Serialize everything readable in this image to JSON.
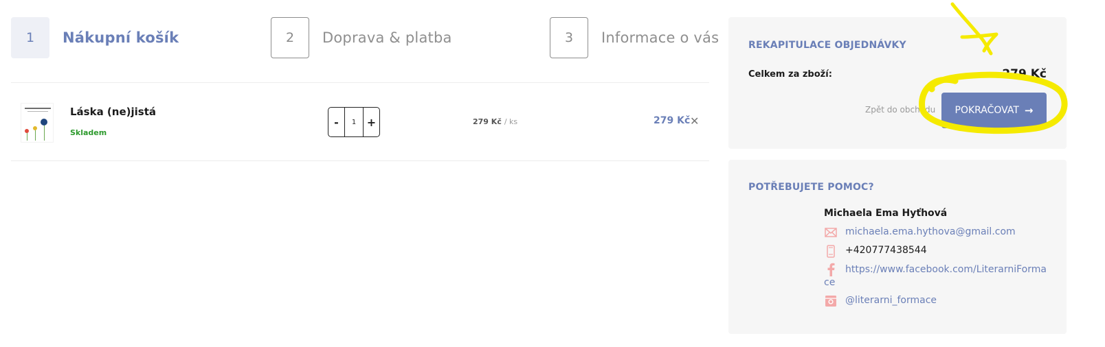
{
  "steps": [
    {
      "number": "1",
      "label": "Nákupní košík",
      "active": true
    },
    {
      "number": "2",
      "label": "Doprava & platba",
      "active": false
    },
    {
      "number": "3",
      "label": "Informace o vás",
      "active": false
    }
  ],
  "cart": {
    "items": [
      {
        "thumbnail_title": "LÁSKA (NE)JISTÁ",
        "name": "Láska (ne)jistá",
        "stock": "Skladem",
        "quantity": "1",
        "minus": "-",
        "plus": "+",
        "unit_price": "279 Kč",
        "unit_suffix": "/ ks",
        "total": "279 Kč",
        "remove_icon": "close-icon"
      }
    ]
  },
  "recap": {
    "title": "REKAPITULACE OBJEDNÁVKY",
    "sum_label": "Celkem za zboží:",
    "sum_value": "279 Kč",
    "back_link": "Zpět do obchodu",
    "continue_label": "POKRAČOVAT",
    "continue_arrow": "→",
    "highlight_color": "#f5ea00"
  },
  "help": {
    "title": "POTŘEBUJETE POMOC?",
    "name": "Michaela Ema Hyťhová",
    "email": "michaela.ema.hythova@gmail.com",
    "phone": "+420777438544",
    "facebook": "https://www.facebook.com/LiterarniFormace",
    "instagram": "@literarni_formace"
  },
  "colors": {
    "accent": "#6a7fb7",
    "stock": "#2d9a2d",
    "icon": "#f3a9a9",
    "panel_bg": "#f6f6f6"
  }
}
